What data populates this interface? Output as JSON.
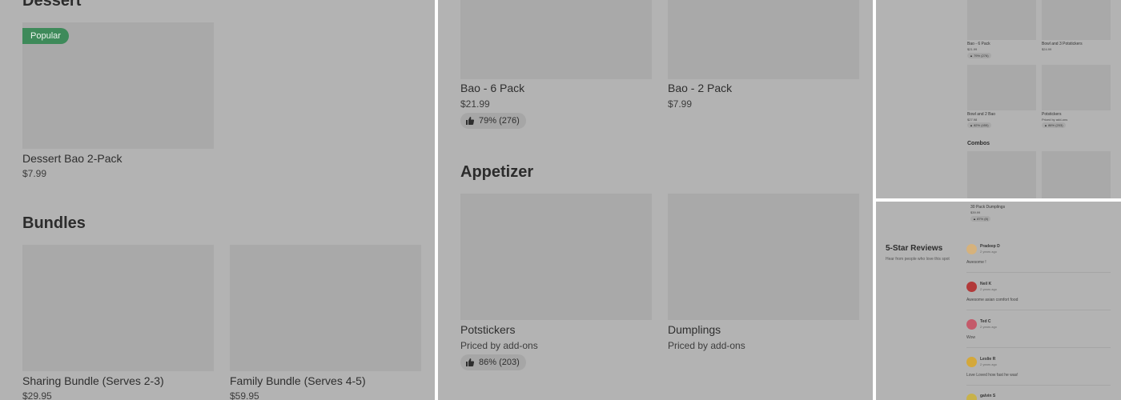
{
  "left": {
    "dessert": {
      "title": "Dessert",
      "badge": "Popular",
      "item_name": "Dessert Bao 2-Pack",
      "item_price": "$7.99"
    },
    "bundles": {
      "title": "Bundles",
      "items": [
        {
          "name": "Sharing Bundle (Serves 2-3)",
          "price": "$29.95"
        },
        {
          "name": "Family Bundle (Serves 4-5)",
          "price": "$59.95"
        }
      ]
    }
  },
  "middle": {
    "items_top": [
      {
        "name": "Bao -  6 Pack",
        "price": "$21.99",
        "rating": "79% (276)"
      },
      {
        "name": " Bao - 2 Pack",
        "price": "$7.99"
      }
    ],
    "appetizer": {
      "title": "Appetizer",
      "items": [
        {
          "name": "Potstickers",
          "price": "Priced by add-ons",
          "rating": "86% (203)"
        },
        {
          "name": " Dumplings",
          "price": "Priced by add-ons"
        }
      ]
    }
  },
  "top_right": {
    "items": [
      {
        "name": "Bao - 6 Pack",
        "price": "$21.99",
        "rating": "79% (276)"
      },
      {
        "name": "Bowl and 3 Potstickers",
        "price": "$24.99"
      },
      {
        "name": "Bowl and 2 Bao",
        "price": "$27.98",
        "rating": "82% (455)"
      },
      {
        "name": "Potstickers",
        "price": "Priced by add-ons",
        "rating": "86% (203)"
      }
    ],
    "combos_title": "Combos"
  },
  "bottom_right": {
    "top_item": {
      "name": "30 Pack Dumplings",
      "price": "$39.99",
      "rating": "87% (8)"
    },
    "title": "5-Star Reviews",
    "subtitle": "Hear from people who love this spot",
    "reviews": [
      {
        "name": "Pradeep D",
        "date": "2 years ago",
        "text": "Awesome !",
        "avatar_color": "#d6b27c"
      },
      {
        "name": "Neil K",
        "date": "2 years ago",
        "text": "Awesome asian comfort food",
        "avatar_color": "#b23a3a"
      },
      {
        "name": "Ted C",
        "date": "2 years ago",
        "text": "Wow",
        "avatar_color": "#c45a6a"
      },
      {
        "name": "Leslie R",
        "date": "2 years ago",
        "text": "Love Loved how fast he was!",
        "avatar_color": "#d4a83a"
      },
      {
        "name": "galvin S",
        "date": "",
        "text": "",
        "avatar_color": "#c8b24a"
      }
    ]
  }
}
